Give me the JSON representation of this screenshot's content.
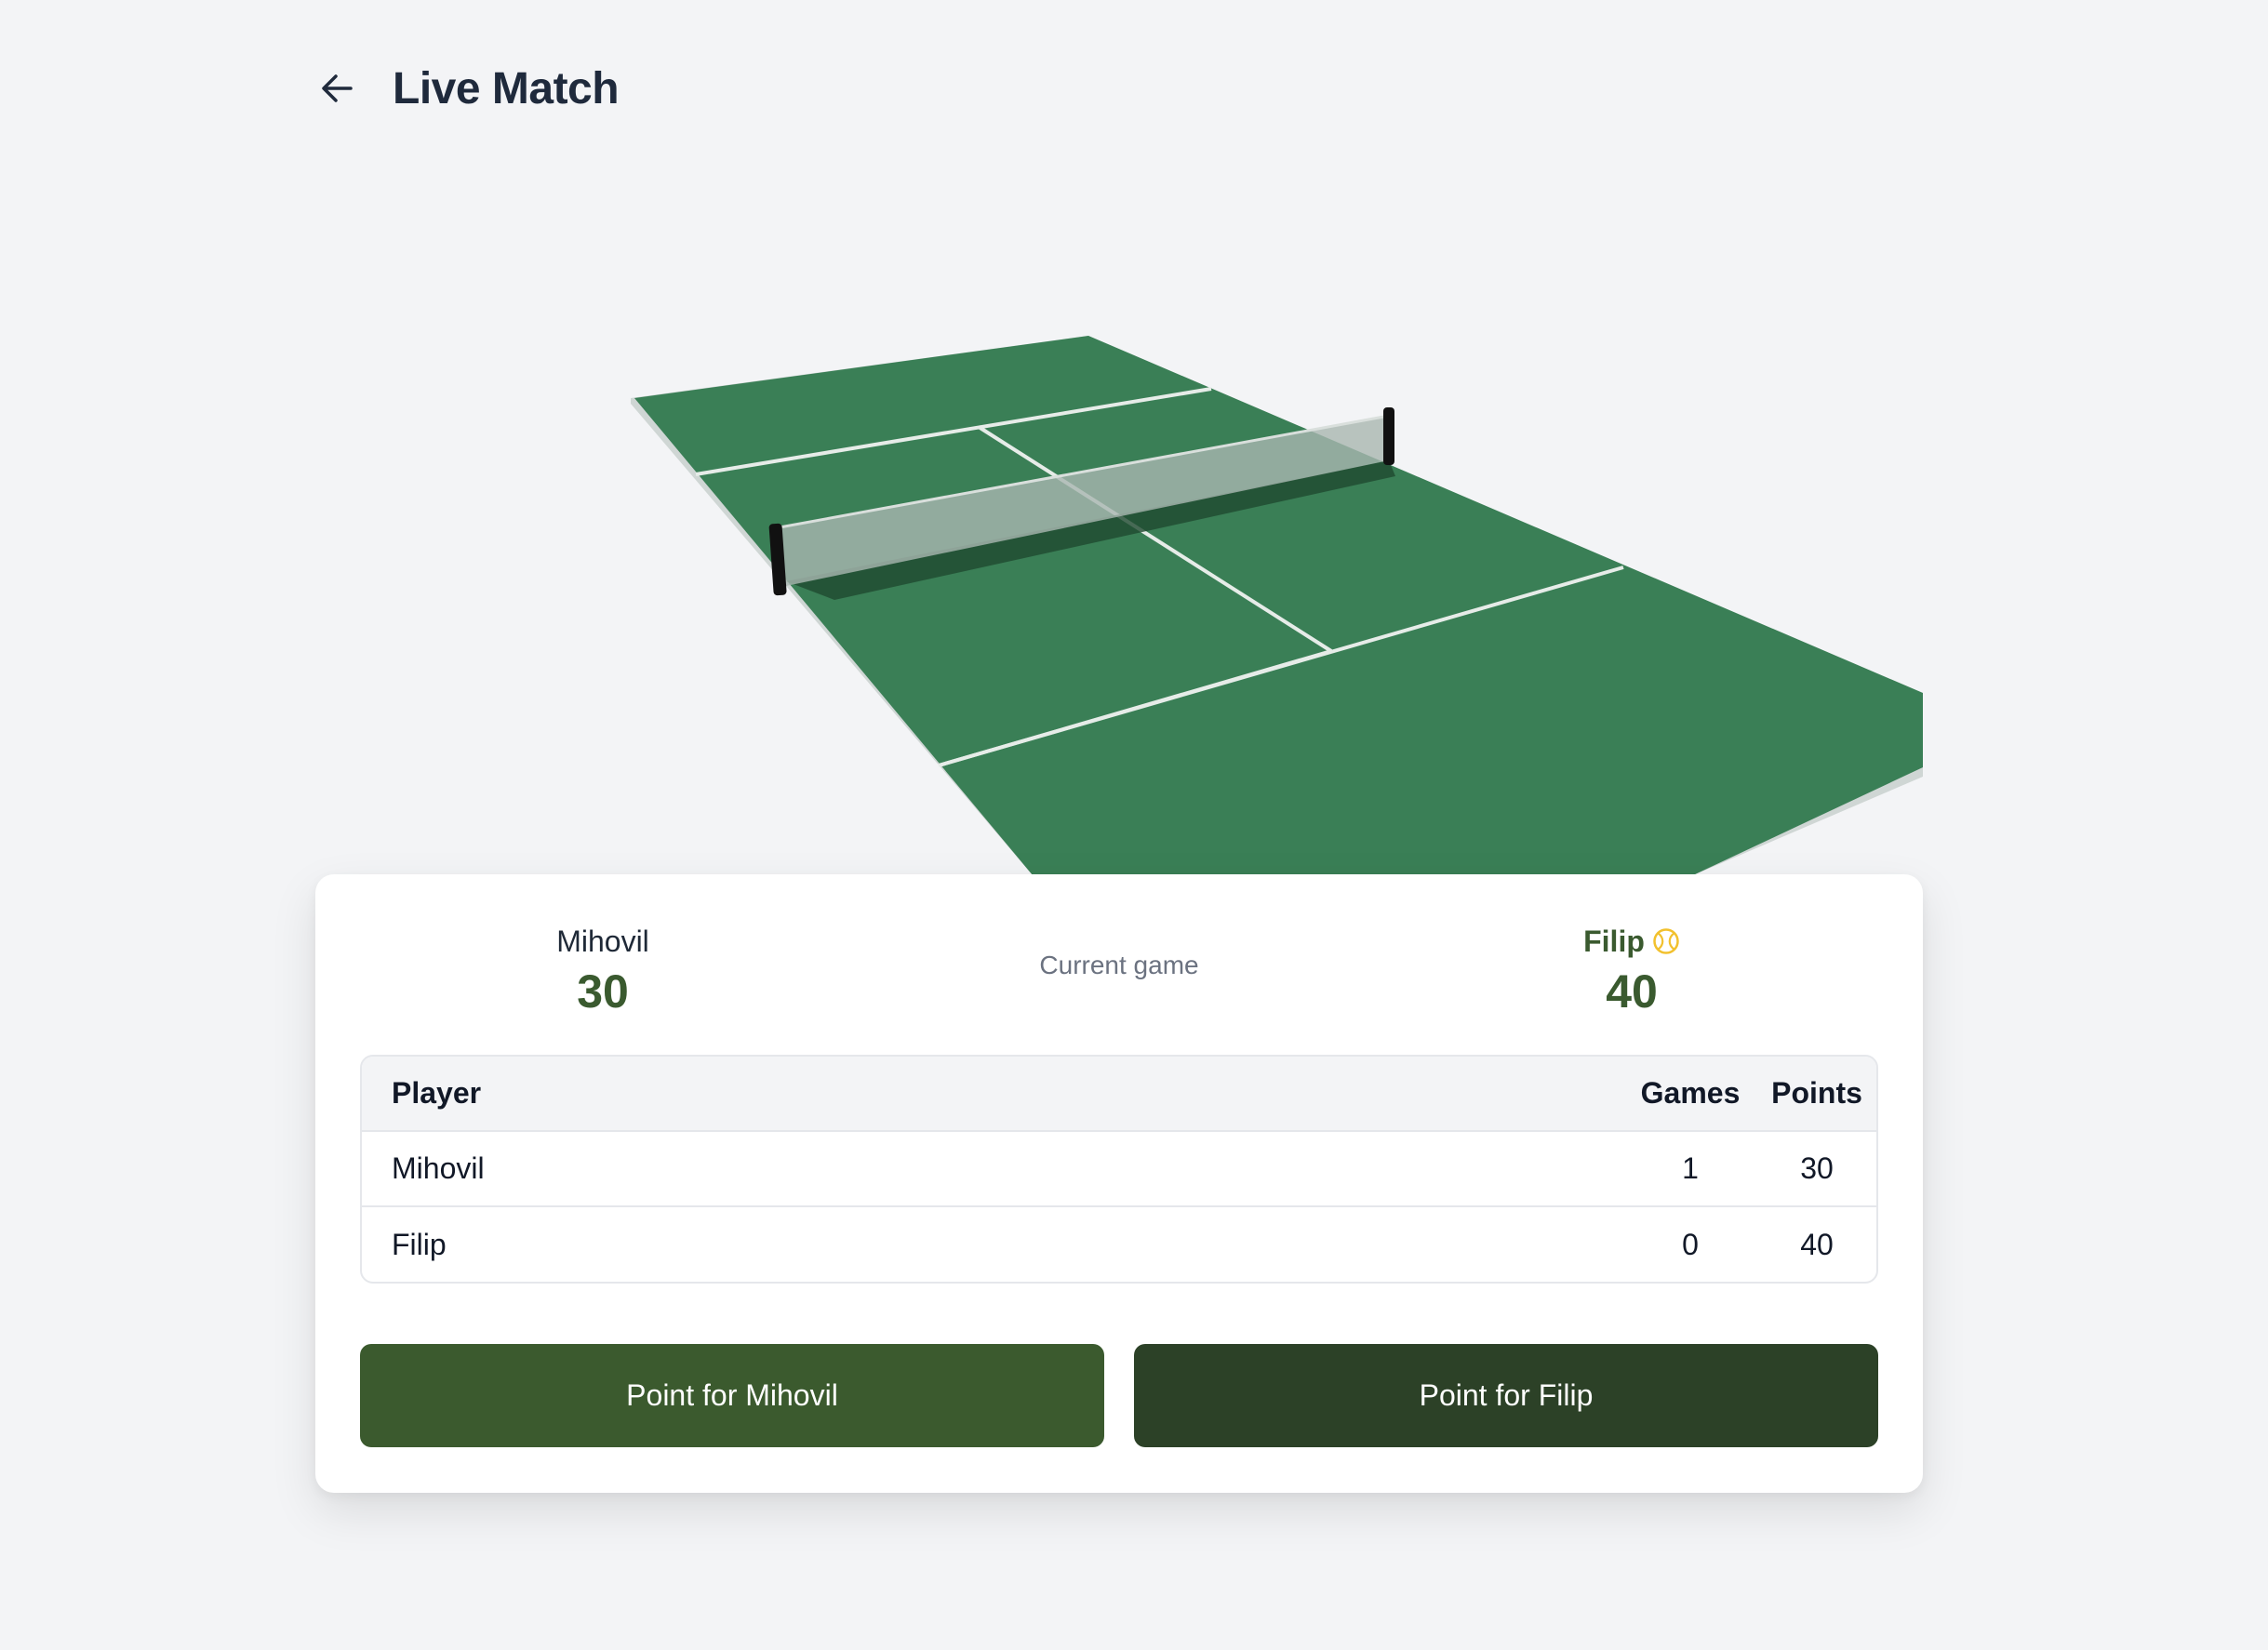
{
  "header": {
    "title": "Live Match"
  },
  "scoreboard": {
    "player1": {
      "name": "Mihovil",
      "score": "30",
      "serving": false
    },
    "player2": {
      "name": "Filip",
      "score": "40",
      "serving": true
    },
    "center_label": "Current game"
  },
  "table": {
    "headers": {
      "player": "Player",
      "games": "Games",
      "points": "Points"
    },
    "rows": [
      {
        "player": "Mihovil",
        "games": "1",
        "points": "30"
      },
      {
        "player": "Filip",
        "games": "0",
        "points": "40"
      }
    ]
  },
  "actions": {
    "point_p1": "Point for Mihovil",
    "point_p2": "Point for Filip"
  },
  "colors": {
    "court": "#3a7f56",
    "accent_dark": "#2c4127",
    "accent": "#3b5a2e",
    "score_green": "#3a5a2f",
    "ball": "#f2c12e"
  },
  "icons": {
    "back": "arrow-left-icon",
    "serve": "tennis-ball-icon"
  }
}
